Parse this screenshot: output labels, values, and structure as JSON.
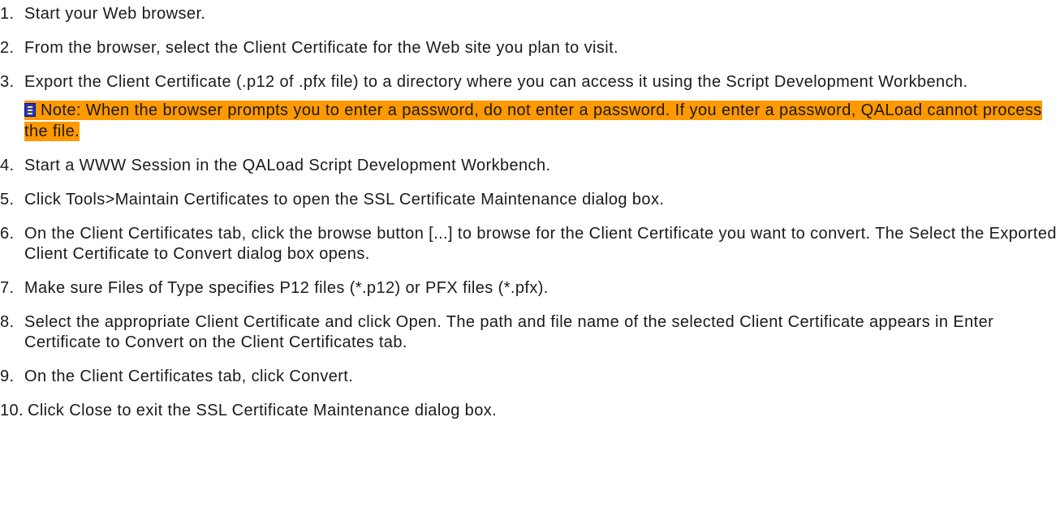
{
  "steps": [
    {
      "num": "1.",
      "text": "Start your Web browser."
    },
    {
      "num": "2.",
      "text": "From the browser, select the Client Certificate for the Web site you plan to visit."
    },
    {
      "num": "3.",
      "text": "Export the Client Certificate (.p12 of .pfx file) to a directory where you can access it using the Script Development Workbench."
    },
    {
      "num": "4.",
      "text": "Start a WWW Session in the QALoad Script Development Workbench."
    },
    {
      "num": "5.",
      "text": "Click Tools>Maintain Certificates to open the SSL Certificate Maintenance dialog box."
    },
    {
      "num": "6.",
      "text": "On the Client Certificates tab, click the browse button [...] to browse for the Client Certificate you want to convert. The Select the Exported Client Certificate to Convert dialog box opens."
    },
    {
      "num": "7.",
      "text": "Make sure Files of Type specifies P12 files (*.p12) or PFX files (*.pfx)."
    },
    {
      "num": "8.",
      "text": "Select the appropriate Client Certificate and click Open. The path and file name of the selected Client Certificate appears in Enter Certificate to Convert on the Client Certificates tab."
    },
    {
      "num": "9.",
      "text": "On the Client Certificates tab, click Convert."
    },
    {
      "num": "10.",
      "text": "Click Close to exit the SSL Certificate Maintenance dialog box."
    }
  ],
  "note": {
    "icon": "note-icon",
    "text": "Note: When the browser prompts you to enter a password, do not enter a password. If you enter a password, QALoad cannot process the file.",
    "highlight_color": "#ff9900"
  }
}
